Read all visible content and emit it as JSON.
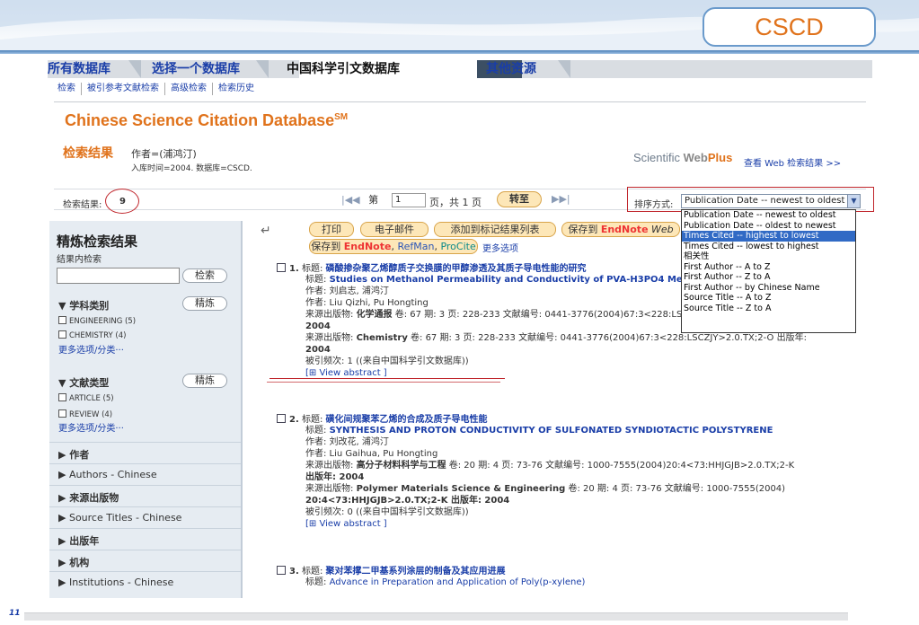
{
  "slide": {
    "badge": "CSCD",
    "page_number": "11"
  },
  "nav": {
    "tabs": [
      "所有数据库",
      "选择一个数据库",
      "中国科学引文数据库",
      "其他资源"
    ],
    "subnav": [
      "检索",
      "被引参考文献检索",
      "高级检索",
      "检索历史"
    ]
  },
  "db_title": "Chinese Science Citation Database",
  "db_title_sup": "SM",
  "results_header": {
    "label": "检索结果",
    "query": "作者=(浦鸿汀)",
    "sub": "入库时间=2004. 数据库=CSCD.",
    "webplus_a": "Scientific ",
    "webplus_b": "Web",
    "webplus_c": "Plus",
    "webplus_link": "查看 Web 检索结果 >>"
  },
  "count": {
    "label": "检索结果:",
    "value": "9"
  },
  "pager": {
    "first": "|◀◀",
    "page_prefix": "第",
    "page_value": "1",
    "page_suffix": "页，共 1 页",
    "go": "转至",
    "last": "▶▶|"
  },
  "sort": {
    "label": "排序方式:",
    "selected": "Publication Date -- newest to oldest",
    "options": [
      "Publication Date -- newest to oldest",
      "Publication Date -- oldest to newest",
      "Times Cited -- highest to lowest",
      "Times Cited -- lowest to highest",
      "相关性",
      "First Author -- A to Z",
      "First Author -- Z to A",
      "First Author -- by Chinese Name",
      "Source Title -- A to Z",
      "Source Title -- Z to A"
    ],
    "highlighted_index": 2
  },
  "actions": {
    "print": "打印",
    "email": "电子邮件",
    "add_marked": "添加到标记结果列表",
    "save_to": "保存到",
    "endnote": "EndNote",
    "web": "Web",
    "save_to2": "保存到",
    "refman": "RefMan",
    "procite": "ProCite",
    "more": "更多选项"
  },
  "sidebar": {
    "title": "精炼检索结果",
    "sub": "结果内检索",
    "search_btn": "检索",
    "refine_btn": "精炼",
    "subject_heading": "▼ 学科类别",
    "subjects": [
      "ENGINEERING (5)",
      "CHEMISTRY (4)"
    ],
    "more": "更多选项/分类···",
    "doctype_heading": "▼ 文献类型",
    "doctypes": [
      "ARTICLE (5)",
      "REVIEW (4)"
    ],
    "rows": [
      "▶ 作者",
      "▶ Authors - Chinese",
      "▶ 来源出版物",
      "▶ Source Titles - Chinese",
      "▶ 出版年",
      "▶ 机构",
      "▶ Institutions - Chinese"
    ]
  },
  "records": [
    {
      "num": "1.",
      "title_label": "标题:",
      "title_cn": "磷酸掺杂聚乙烯醇质子交换膜的甲醇渗透及其质子导电性能的研究",
      "title_en_label": "标题:",
      "title_en": "Studies on Methanol Permeability and Conductivity of PVA-H3PO4 Membrane",
      "authors_cn": "作者: 刘启志, 浦鸿汀",
      "authors_en": "作者: Liu Qizhi, Pu Hongting",
      "source_cn_label": "来源出版物:",
      "source_cn": "化学通报",
      "source_cn_tail": " 卷: 67 期: 3 页: 228-233 文献编号: 0441-3776(2004)67:3<228:LSCZJY>2.0.TX;2-O 出版年:",
      "year1": "2004",
      "source_en_label": "来源出版物:",
      "source_en": "Chemistry",
      "source_en_tail": " 卷: 67 期: 3 页: 228-233 文献编号: 0441-3776(2004)67:3<228:LSCZJY>2.0.TX;2-O 出版年:",
      "year2": "2004",
      "cited": "被引频次: 1 ((来自中国科学引文数据库))",
      "abstract": "[⊞ View abstract ]"
    },
    {
      "num": "2.",
      "title_label": "标题:",
      "title_cn": "磺化间规聚苯乙烯的合成及质子导电性能",
      "title_en_label": "标题:",
      "title_en": "SYNTHESIS AND PROTON CONDUCTIVITY OF SULFONATED SYNDIOTACTIC POLYSTYRENE",
      "authors_cn": "作者: 刘改花, 浦鸿汀",
      "authors_en": "作者: Liu Gaihua, Pu Hongting",
      "source_cn_label": "来源出版物:",
      "source_cn": "高分子材料科学与工程",
      "source_cn_tail": " 卷: 20 期: 4 页: 73-76 文献编号: 1000-7555(2004)20:4<73:HHJGJB>2.0.TX;2-K",
      "year1": "出版年: 2004",
      "source_en_label": "来源出版物:",
      "source_en": "Polymer Materials Science & Engineering",
      "source_en_tail": " 卷: 20 期: 4 页: 73-76 文献编号: 1000-7555(2004)",
      "year2": "20:4<73:HHJGJB>2.0.TX;2-K 出版年: 2004",
      "cited": "被引频次: 0 ((来自中国科学引文数据库))",
      "abstract": "[⊞ View abstract ]"
    },
    {
      "num": "3.",
      "title_label": "标题:",
      "title_cn": "聚对苯撑二甲基系列涂层的制备及其应用进展",
      "title_en_label": "标题:",
      "title_en": "Advance in Preparation and Application of Poly(p-xylene)"
    }
  ]
}
